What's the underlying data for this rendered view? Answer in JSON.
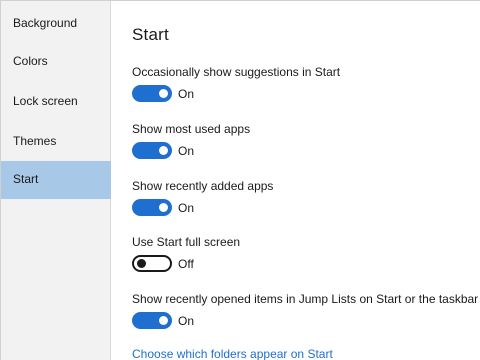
{
  "sidebar": {
    "items": [
      {
        "label": "Background"
      },
      {
        "label": "Colors"
      },
      {
        "label": "Lock screen"
      },
      {
        "label": "Themes"
      },
      {
        "label": "Start"
      }
    ],
    "selected": "Start"
  },
  "main": {
    "title": "Start",
    "settings": [
      {
        "label": "Occasionally show suggestions in Start",
        "state": "On"
      },
      {
        "label": "Show most used apps",
        "state": "On"
      },
      {
        "label": "Show recently added apps",
        "state": "On"
      },
      {
        "label": "Use Start full screen",
        "state": "Off"
      },
      {
        "label": "Show recently opened items in Jump Lists on Start or the taskbar",
        "state": "On"
      }
    ],
    "link": "Choose which folders appear on Start"
  },
  "colors": {
    "accent": "#1f6fd0",
    "sidebar_bg": "#f2f2f2",
    "selected_bg": "#a8c8e8"
  }
}
